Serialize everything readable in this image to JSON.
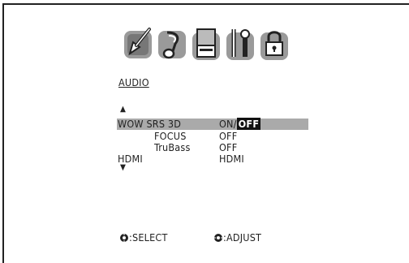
{
  "menu": {
    "title": "AUDIO",
    "rows": [
      {
        "label": "WOW SRS 3D",
        "value_on": "ON",
        "sep": "/",
        "value_off": "OFF"
      },
      {
        "label": "FOCUS",
        "value": "OFF"
      },
      {
        "label": "TruBass",
        "value": "OFF"
      },
      {
        "label": "HDMI",
        "value": "HDMI"
      }
    ]
  },
  "tabs": [
    {
      "name": "picture-icon"
    },
    {
      "name": "audio-icon"
    },
    {
      "name": "setup-icon"
    },
    {
      "name": "tools-icon"
    },
    {
      "name": "lock-icon"
    }
  ],
  "footer": {
    "select_label": ":SELECT",
    "adjust_label": ":ADJUST"
  },
  "colors": {
    "highlight": "#aaaaaa",
    "icon_gray": "#8a8a8a",
    "text": "#222222"
  }
}
